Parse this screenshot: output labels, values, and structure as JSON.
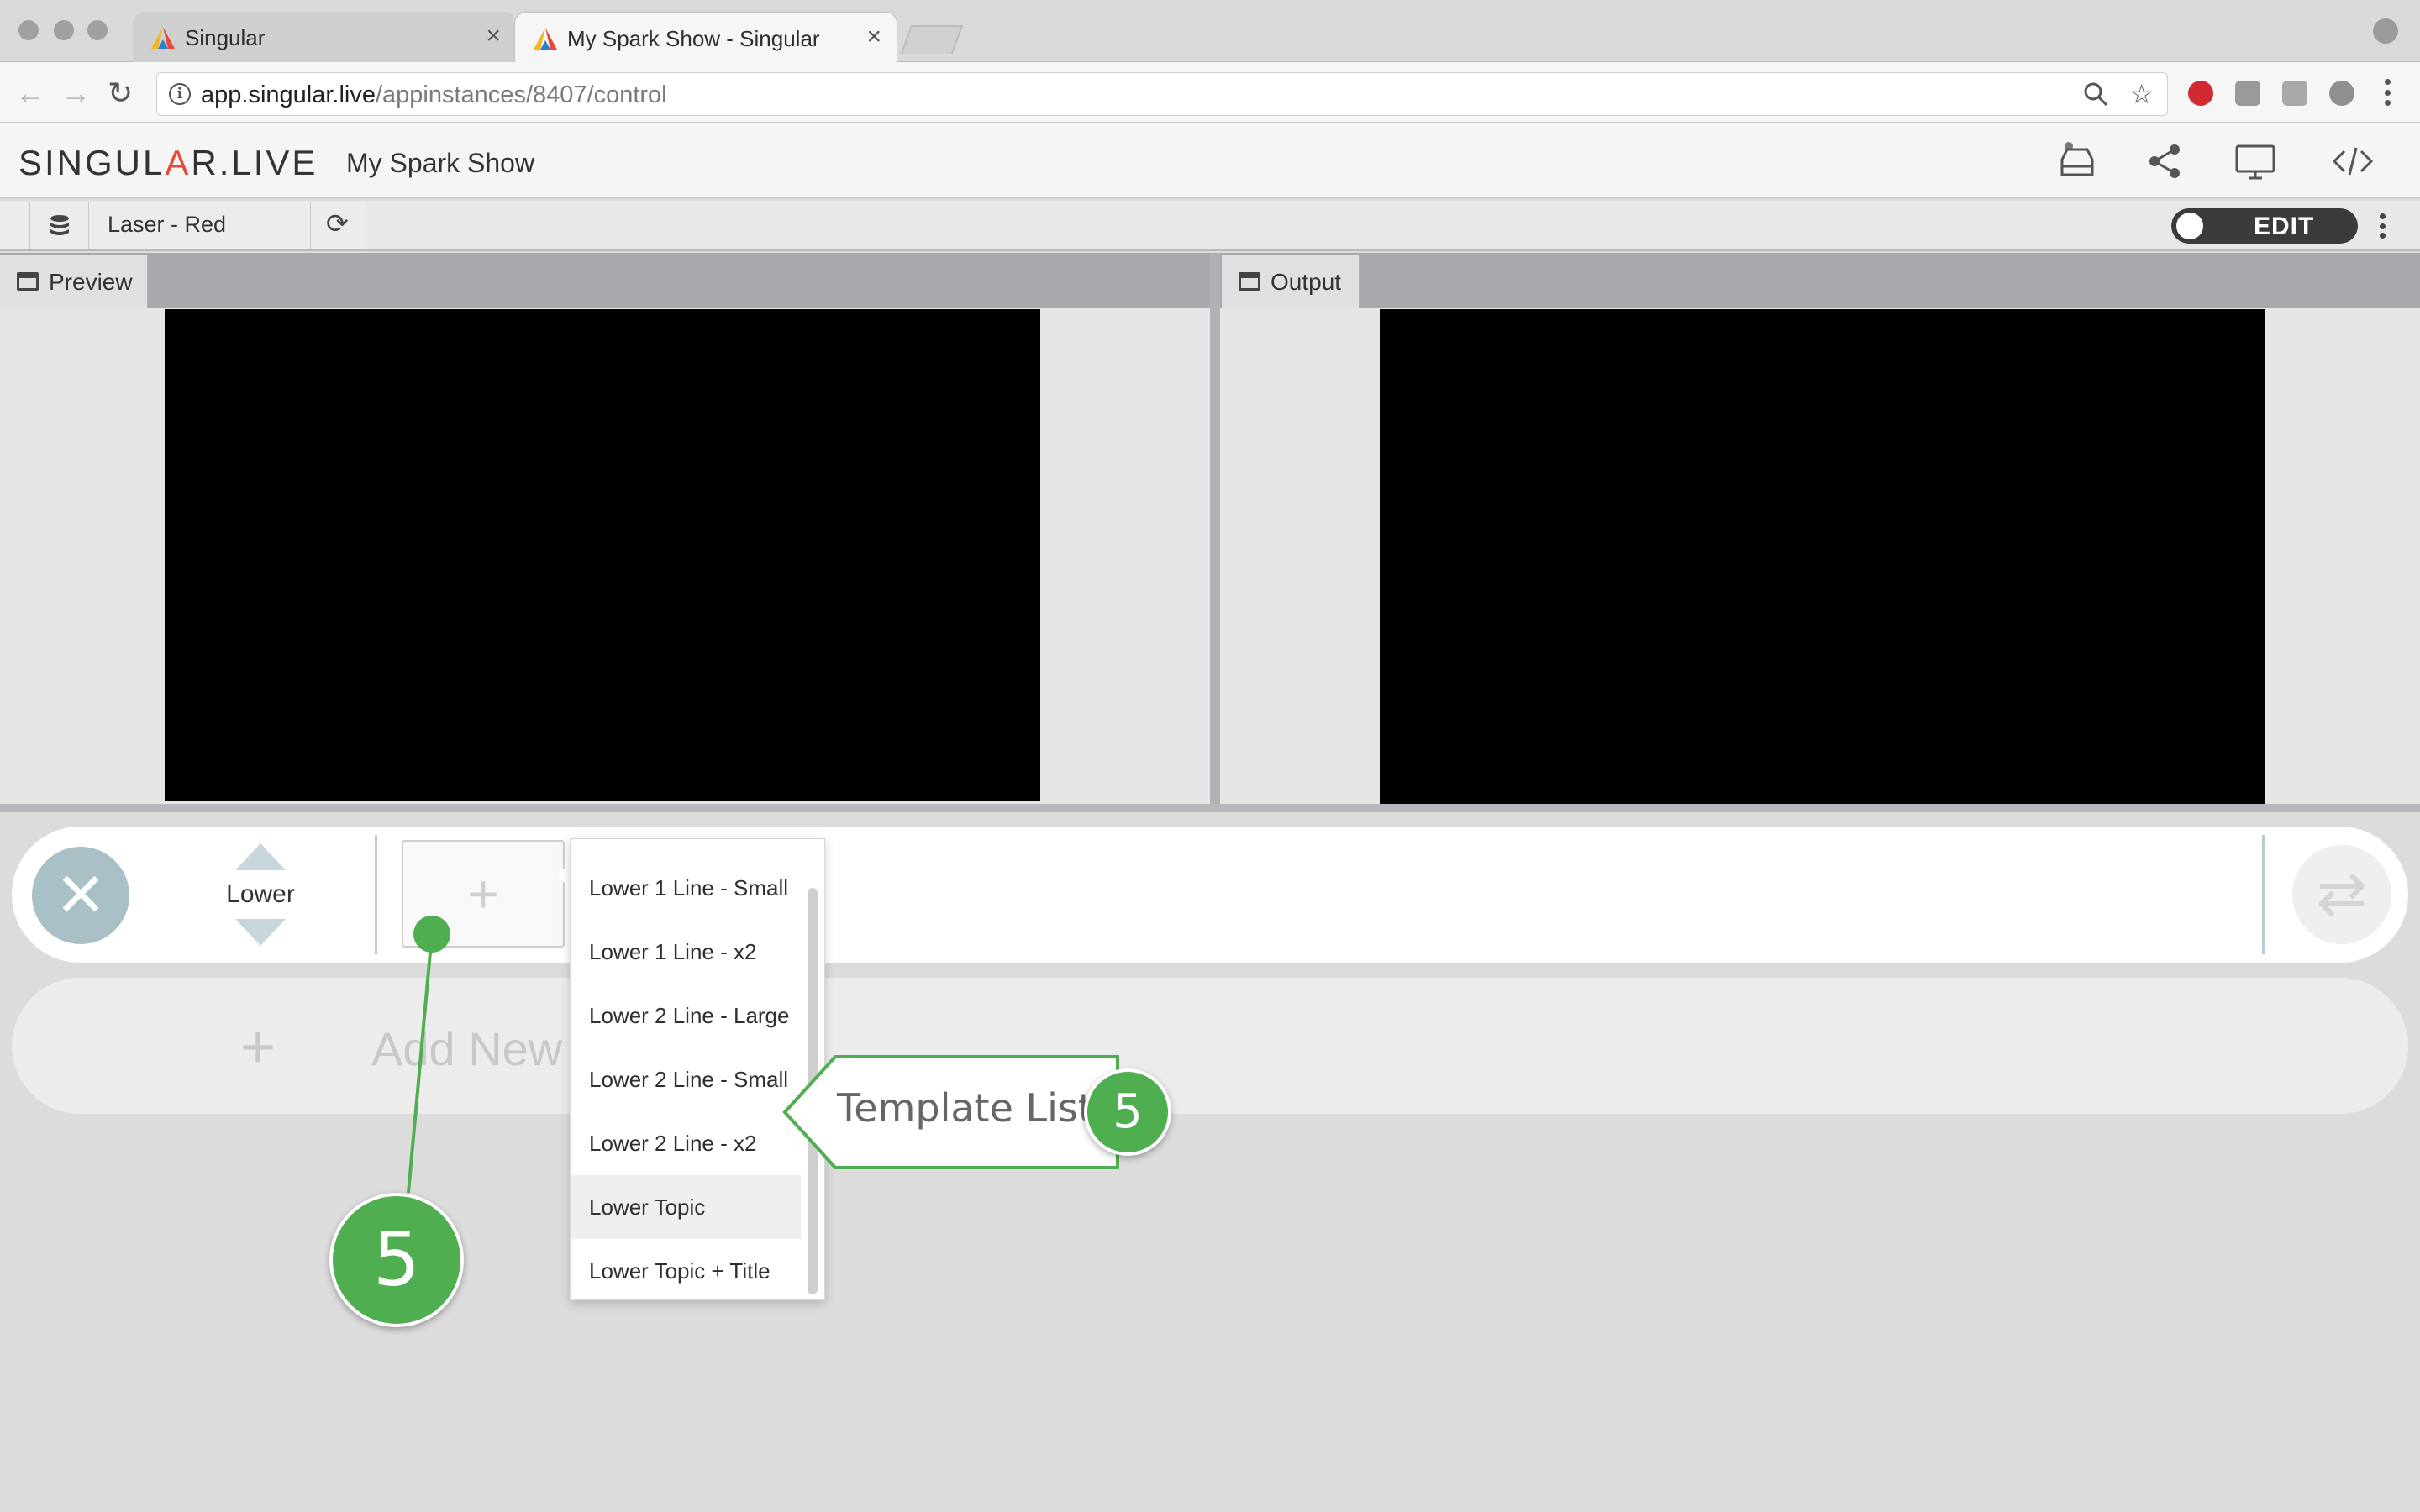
{
  "browser": {
    "tabs": [
      {
        "title": "Singular",
        "active": false
      },
      {
        "title": "My Spark Show - Singular",
        "active": true
      }
    ],
    "url_host": "app.singular.live",
    "url_path": "/appinstances/8407/control"
  },
  "app": {
    "brand_left": "SINGUL",
    "brand_a": "A",
    "brand_right": "R.LIVE",
    "show_title": "My Spark Show",
    "icons": [
      "inbox-icon",
      "share-icon",
      "monitor-icon",
      "code-icon"
    ]
  },
  "subbar": {
    "composition": "Laser - Red",
    "edit_label": "EDIT"
  },
  "panes": {
    "preview_label": "Preview",
    "output_label": "Output"
  },
  "layer": {
    "name": "Lower",
    "add_plus": "+",
    "add_new_label": "Add New C"
  },
  "dropdown": {
    "items": [
      "Lower 1 Line - Small",
      "Lower 1 Line - x2",
      "Lower 2 Line - Large",
      "Lower 2 Line - Small",
      "Lower 2 Line - x2",
      "Lower Topic",
      "Lower Topic + Title"
    ],
    "highlighted_item": "Lower Topic"
  },
  "annotations": {
    "callout_text": "Template List",
    "callout_number": "5",
    "pin_number": "5"
  },
  "colors": {
    "accent_green": "#4fae4f",
    "close_circle": "#a9c0c7",
    "edit_toggle": "#3b3b3b"
  }
}
